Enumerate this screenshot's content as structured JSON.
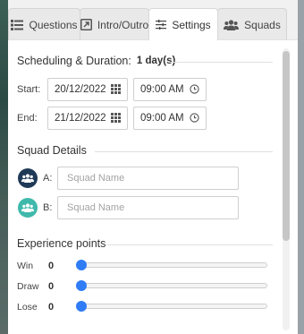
{
  "tabs": [
    {
      "label": "Questions",
      "icon": "list-icon",
      "active": false
    },
    {
      "label": "Intro/Outro",
      "icon": "external-link-icon",
      "active": false
    },
    {
      "label": "Settings",
      "icon": "sliders-icon",
      "active": true
    },
    {
      "label": "Squads",
      "icon": "users-icon",
      "active": false
    }
  ],
  "schedule": {
    "title": "Scheduling & Duration:",
    "duration": "1 day(s)",
    "start": {
      "label": "Start:",
      "date": "20/12/2022",
      "time": "09:00 AM"
    },
    "end": {
      "label": "End:",
      "date": "21/12/2022",
      "time": "09:00 AM"
    }
  },
  "squads": {
    "title": "Squad Details",
    "items": [
      {
        "label": "A:",
        "placeholder": "Squad Name",
        "value": "",
        "color": "#1f3a56"
      },
      {
        "label": "B:",
        "placeholder": "Squad Name",
        "value": "",
        "color": "#3fb9ab"
      }
    ]
  },
  "experience": {
    "title": "Experience points",
    "rows": [
      {
        "label": "Win",
        "value": "0",
        "level": 0
      },
      {
        "label": "Draw",
        "value": "0",
        "level": 0
      },
      {
        "label": "Lose",
        "value": "0",
        "level": 0
      }
    ]
  },
  "colors": {
    "accent": "#2f7cf6",
    "squad_a": "#1f3a56",
    "squad_b": "#3fb9ab"
  }
}
